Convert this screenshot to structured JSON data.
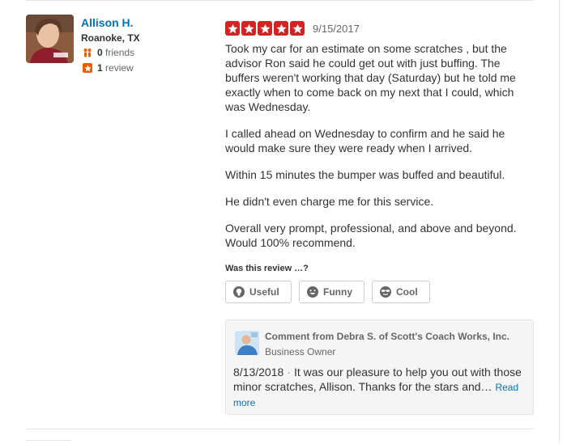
{
  "user": {
    "name": "Allison H.",
    "location": "Roanoke, TX",
    "friends_count": "0",
    "friends_label": "friends",
    "reviews_count": "1",
    "reviews_label": "review"
  },
  "review": {
    "rating": 5,
    "date": "9/15/2017",
    "paragraphs": [
      "Took my car for an estimate on some scratches , but the advisor Ron said he could get out with just buffing. The buffers weren't working that day (Saturday) but he told me exactly when to come back on my next that I could, which was Wednesday.",
      "I called ahead on Wednesday to confirm and he said he would make sure they were ready when I arrived.",
      "Within 15 minutes the bumper was buffed and beautiful.",
      "He didn't even charge me for this service.",
      "Overall very prompt, professional, and above and beyond. Would 100% recommend."
    ]
  },
  "votes": {
    "question": "Was this review …?",
    "useful": "Useful",
    "funny": "Funny",
    "cool": "Cool"
  },
  "comment": {
    "from": "Comment from Debra S. of Scott's Coach Works, Inc.",
    "role": "Business Owner",
    "date": "8/13/2018",
    "separator": "·",
    "text": "It was our pleasure to help you out with those minor scratches, Allison. Thanks for the stars and…",
    "read_more": "Read more"
  },
  "colors": {
    "star": "#d32323",
    "link": "#0073bb",
    "review_icon": "#f15c00",
    "friends_icon": "#f15c00"
  }
}
